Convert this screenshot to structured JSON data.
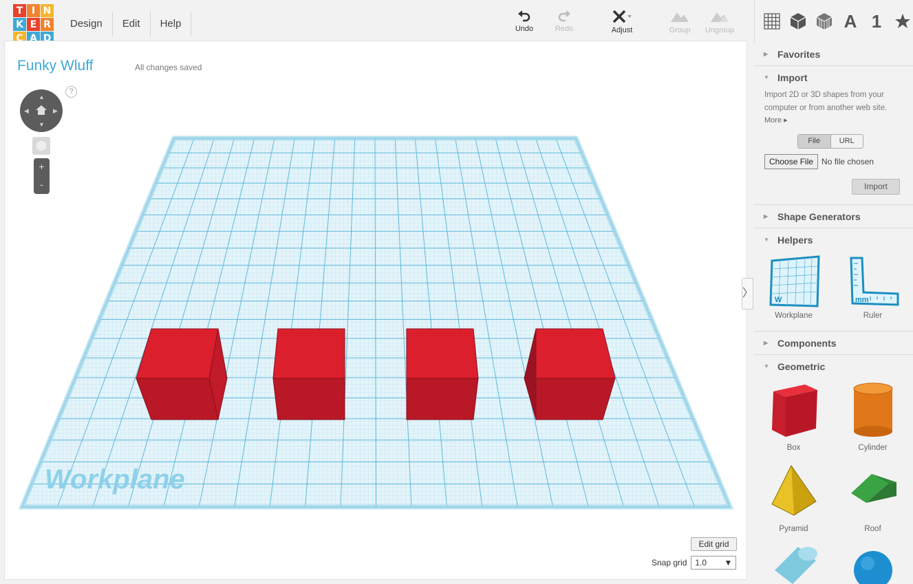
{
  "logo": {
    "letters": [
      "T",
      "I",
      "N",
      "K",
      "E",
      "R",
      "C",
      "A",
      "D"
    ],
    "colors": [
      "#e8412c",
      "#f0832e",
      "#f7b52b",
      "#3fa9d6",
      "#e8412c",
      "#f0832e",
      "#f7b52b",
      "#3fa9d6",
      "#3fa9d6"
    ]
  },
  "menu": [
    {
      "label": "Design"
    },
    {
      "label": "Edit"
    },
    {
      "label": "Help"
    }
  ],
  "toolbar": {
    "undo": "Undo",
    "redo": "Redo",
    "adjust": "Adjust",
    "group": "Group",
    "ungroup": "Ungroup"
  },
  "view_icons": {
    "text_icon": "A",
    "number_icon": "1"
  },
  "design": {
    "title": "Funky Wluff",
    "status": "All changes saved"
  },
  "navigation": {
    "help": "?",
    "zoom_in": "+",
    "zoom_out": "-"
  },
  "workplane": {
    "label": "Workplane"
  },
  "grid": {
    "edit_label": "Edit grid",
    "snap_label": "Snap grid",
    "snap_value": "1.0"
  },
  "shapes_on_plane": {
    "count": 4,
    "color": "#dc1f2d"
  },
  "panel": {
    "favorites": "Favorites",
    "import": {
      "title": "Import",
      "description": "Import 2D or 3D shapes from your computer or from another web site.",
      "more": "More",
      "tabs": [
        "File",
        "URL"
      ],
      "choose_file": "Choose File",
      "no_file": "No file chosen",
      "button": "Import"
    },
    "shape_generators": "Shape Generators",
    "helpers": {
      "title": "Helpers",
      "items": [
        {
          "label": "Workplane"
        },
        {
          "label": "Ruler"
        }
      ]
    },
    "components": "Components",
    "geometric": {
      "title": "Geometric",
      "items": [
        {
          "label": "Box"
        },
        {
          "label": "Cylinder"
        },
        {
          "label": "Pyramid"
        },
        {
          "label": "Roof"
        }
      ]
    }
  },
  "icons": {
    "undo": "undo-icon",
    "redo": "redo-icon",
    "adjust": "adjust-icon",
    "group": "group-icon",
    "ungroup": "ungroup-icon"
  }
}
